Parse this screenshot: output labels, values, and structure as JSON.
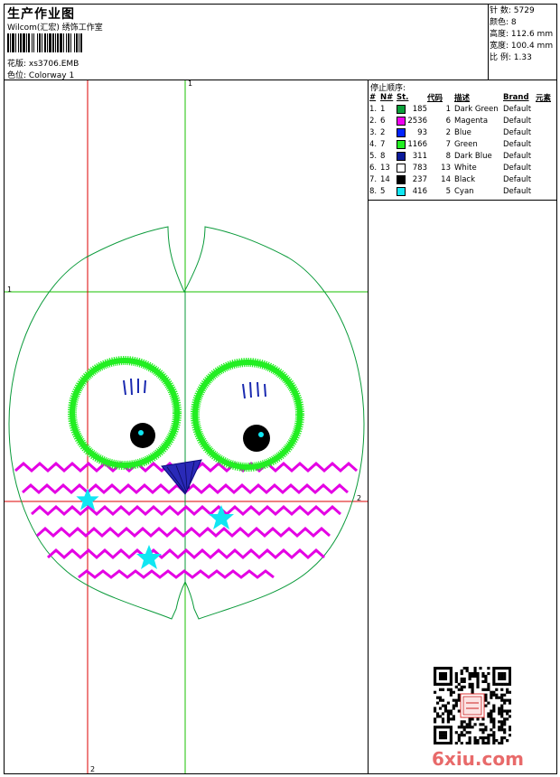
{
  "header": {
    "title": "生产作业图",
    "software": "Wilcom(汇宏) 绣饰工作室",
    "design_label": "花版:",
    "design_value": "xs3706.EMB",
    "colorway_label": "色位:",
    "colorway_value": "Colorway 1"
  },
  "stats": [
    {
      "label": "针 数:",
      "value": "5729"
    },
    {
      "label": "颜色:",
      "value": "8"
    },
    {
      "label": "高度:",
      "value": "112.6 mm"
    },
    {
      "label": "宽度:",
      "value": "100.4 mm"
    },
    {
      "label": "比 例:",
      "value": "1.33"
    }
  ],
  "stop_sequence_label": "停止顺序:",
  "color_table": {
    "headers": [
      "#",
      "N#",
      "St.",
      "代码",
      "描述",
      "Brand",
      "元素"
    ],
    "rows": [
      {
        "seq": "1.",
        "n": "1",
        "st": "185",
        "code": "1",
        "desc": "Dark Green",
        "brand": "Default",
        "color": "#0aa03a"
      },
      {
        "seq": "2.",
        "n": "6",
        "st": "2536",
        "code": "6",
        "desc": "Magenta",
        "brand": "Default",
        "color": "#f000f0"
      },
      {
        "seq": "3.",
        "n": "2",
        "st": "93",
        "code": "2",
        "desc": "Blue",
        "brand": "Default",
        "color": "#0024ff"
      },
      {
        "seq": "4.",
        "n": "7",
        "st": "1166",
        "code": "7",
        "desc": "Green",
        "brand": "Default",
        "color": "#22ee22"
      },
      {
        "seq": "5.",
        "n": "8",
        "st": "311",
        "code": "8",
        "desc": "Dark Blue",
        "brand": "Default",
        "color": "#0a1a9a"
      },
      {
        "seq": "6.",
        "n": "13",
        "st": "783",
        "code": "13",
        "desc": "White",
        "brand": "Default",
        "color": "#ffffff"
      },
      {
        "seq": "7.",
        "n": "14",
        "st": "237",
        "code": "14",
        "desc": "Black",
        "brand": "Default",
        "color": "#000000"
      },
      {
        "seq": "8.",
        "n": "5",
        "st": "416",
        "code": "5",
        "desc": "Cyan",
        "brand": "Default",
        "color": "#11e6f2"
      }
    ]
  },
  "guides": {
    "v_green": "1",
    "h_green": "1",
    "h_red": "2",
    "v_red": "2"
  },
  "watermark": "6xiu.com"
}
